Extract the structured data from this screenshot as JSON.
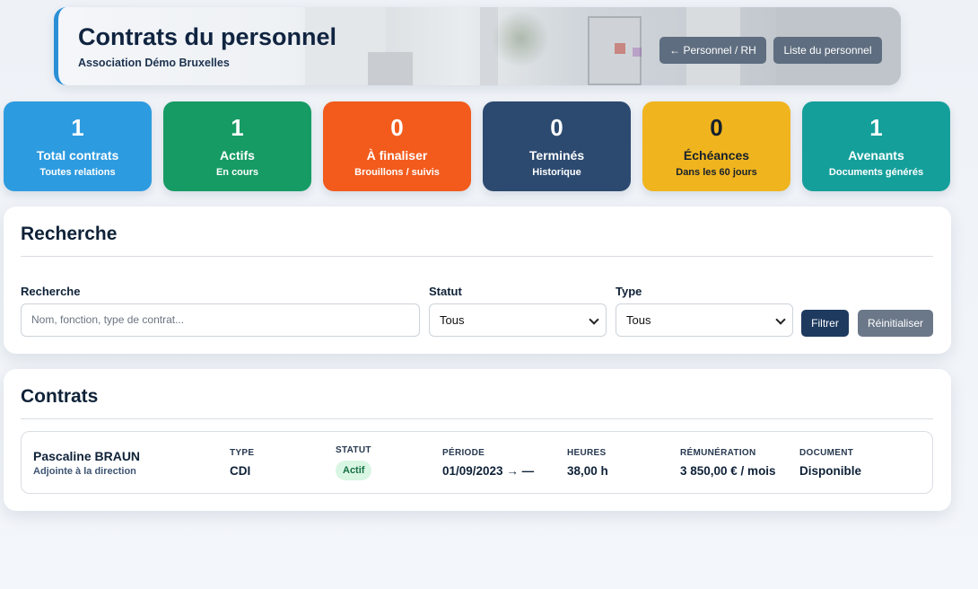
{
  "header": {
    "title": "Contrats du personnel",
    "subtitle": "Association Démo Bruxelles",
    "back_button": "← Personnel / RH",
    "list_button": "Liste du personnel"
  },
  "stats": [
    {
      "value": "1",
      "label": "Total contrats",
      "sub": "Toutes relations",
      "color": "#2d9be0"
    },
    {
      "value": "1",
      "label": "Actifs",
      "sub": "En cours",
      "color": "#169b64"
    },
    {
      "value": "0",
      "label": "À finaliser",
      "sub": "Brouillons / suivis",
      "color": "#f25b1c"
    },
    {
      "value": "0",
      "label": "Terminés",
      "sub": "Historique",
      "color": "#2c4a70"
    },
    {
      "value": "0",
      "label": "Échéances",
      "sub": "Dans les 60 jours",
      "color": "#f0b41e"
    },
    {
      "value": "1",
      "label": "Avenants",
      "sub": "Documents générés",
      "color": "#159f9b"
    }
  ],
  "search": {
    "title": "Recherche",
    "search_label": "Recherche",
    "search_placeholder": "Nom, fonction, type de contrat...",
    "status_label": "Statut",
    "status_value": "Tous",
    "type_label": "Type",
    "type_value": "Tous",
    "filter_button": "Filtrer",
    "reset_button": "Réinitialiser"
  },
  "contracts": {
    "title": "Contrats",
    "columns": {
      "type": "TYPE",
      "status": "STATUT",
      "period": "PÉRIODE",
      "hours": "HEURES",
      "salary": "RÉMUNÉRATION",
      "document": "DOCUMENT"
    },
    "rows": [
      {
        "name": "Pascaline BRAUN",
        "role": "Adjointe à la direction",
        "type": "CDI",
        "status": "Actif",
        "period": "01/09/2023 → —",
        "hours": "38,00 h",
        "salary": "3 850,00 € / mois",
        "document": "Disponible"
      }
    ]
  }
}
